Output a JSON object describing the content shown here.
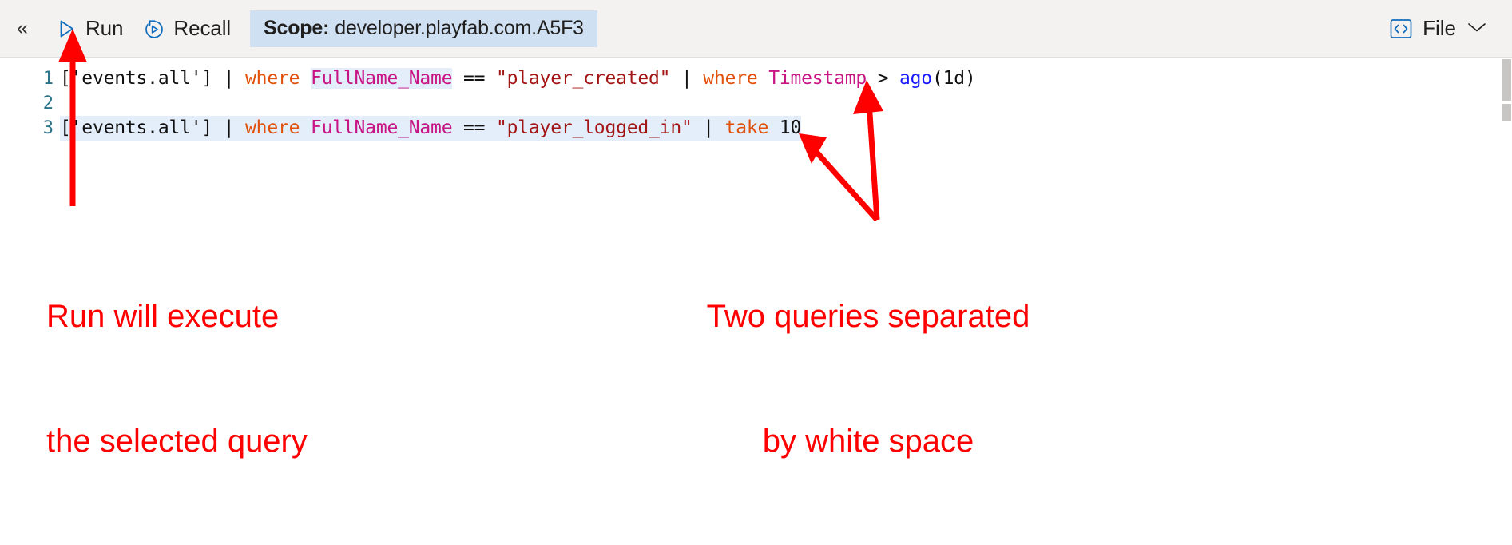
{
  "toolbar": {
    "collapse_icon": "chevron-double-left",
    "run": {
      "label": "Run",
      "icon": "play-triangle-icon"
    },
    "recall": {
      "label": "Recall",
      "icon": "history-recall-icon"
    },
    "scope": {
      "label": "Scope:",
      "value": "developer.playfab.com.A5F3"
    },
    "file": {
      "label": "File",
      "icon": "code-brackets-icon",
      "chevron": "chevron-down-icon"
    }
  },
  "editor": {
    "line_numbers": [
      "1",
      "2",
      "3"
    ],
    "lines": [
      {
        "number": "1",
        "selected": false,
        "tokens": [
          {
            "text": "['events.all']",
            "type": "plain"
          },
          {
            "text": " ",
            "type": "plain"
          },
          {
            "text": "|",
            "type": "pipe"
          },
          {
            "text": " ",
            "type": "plain"
          },
          {
            "text": "where",
            "type": "keyword"
          },
          {
            "text": " ",
            "type": "plain"
          },
          {
            "text": "FullName_Name",
            "type": "column",
            "highlighted": true
          },
          {
            "text": " ",
            "type": "plain"
          },
          {
            "text": "==",
            "type": "operator"
          },
          {
            "text": " ",
            "type": "plain"
          },
          {
            "text": "\"player_created\"",
            "type": "string"
          },
          {
            "text": " ",
            "type": "plain"
          },
          {
            "text": "|",
            "type": "pipe"
          },
          {
            "text": " ",
            "type": "plain"
          },
          {
            "text": "where",
            "type": "keyword"
          },
          {
            "text": " ",
            "type": "plain"
          },
          {
            "text": "Timestamp",
            "type": "column"
          },
          {
            "text": " ",
            "type": "plain"
          },
          {
            "text": ">",
            "type": "operator"
          },
          {
            "text": " ",
            "type": "plain"
          },
          {
            "text": "ago",
            "type": "function"
          },
          {
            "text": "(1d)",
            "type": "plain"
          }
        ]
      },
      {
        "number": "2",
        "selected": false,
        "tokens": []
      },
      {
        "number": "3",
        "selected": true,
        "tokens": [
          {
            "text": "['events.all']",
            "type": "plain"
          },
          {
            "text": " ",
            "type": "plain"
          },
          {
            "text": "|",
            "type": "pipe"
          },
          {
            "text": " ",
            "type": "plain"
          },
          {
            "text": "where",
            "type": "keyword"
          },
          {
            "text": " ",
            "type": "plain"
          },
          {
            "text": "FullName_Name",
            "type": "column"
          },
          {
            "text": " ",
            "type": "plain"
          },
          {
            "text": "==",
            "type": "operator"
          },
          {
            "text": " ",
            "type": "plain"
          },
          {
            "text": "\"player_logged_in\"",
            "type": "string"
          },
          {
            "text": " ",
            "type": "plain"
          },
          {
            "text": "|",
            "type": "pipe"
          },
          {
            "text": " ",
            "type": "plain"
          },
          {
            "text": "take",
            "type": "keyword"
          },
          {
            "text": " ",
            "type": "plain"
          },
          {
            "text": "10",
            "type": "plain"
          }
        ]
      }
    ],
    "full_text_lines": [
      "['events.all'] | where FullName_Name == \"player_created\" | where Timestamp > ago(1d)",
      "",
      "['events.all'] | where FullName_Name == \"player_logged_in\" | take 10"
    ]
  },
  "annotations": {
    "color": "#ff0000",
    "run_note": {
      "line1": "Run will execute",
      "line2": "the selected query"
    },
    "queries_note": {
      "line1": "Two queries separated",
      "line2": "by white space"
    }
  }
}
